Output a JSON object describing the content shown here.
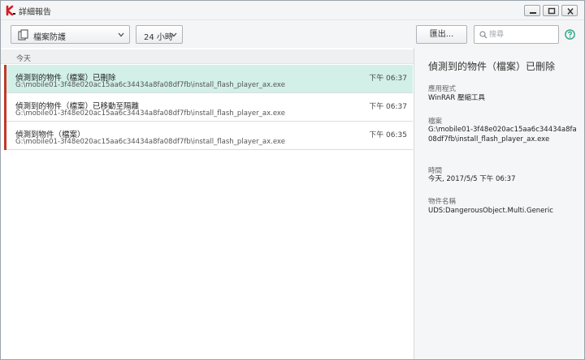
{
  "window": {
    "title": "詳細報告"
  },
  "toolbar": {
    "component_dropdown": "檔案防護",
    "period_dropdown": "24 小時",
    "export_label": "匯出...",
    "search_placeholder": "搜尋"
  },
  "list": {
    "group_label": "今天",
    "events": [
      {
        "title": "偵測到的物件（檔案）已刪除",
        "path": "G:\\mobile01-3f48e020ac15aa6c34434a8fa08df7fb\\install_flash_player_ax.exe",
        "time": "下午 06:37"
      },
      {
        "title": "偵測到的物件（檔案）已移動至隔離",
        "path": "G:\\mobile01-3f48e020ac15aa6c34434a8fa08df7fb\\install_flash_player_ax.exe",
        "time": "下午 06:37"
      },
      {
        "title": "偵測到物件（檔案）",
        "path": "G:\\mobile01-3f48e020ac15aa6c34434a8fa08df7fb\\install_flash_player_ax.exe",
        "time": "下午 06:35"
      }
    ]
  },
  "detail": {
    "title": "偵測到的物件（檔案）已刪除",
    "application_label": "應用程式",
    "application_value": "WinRAR 壓縮工具",
    "file_label": "檔案",
    "file_value": "G:\\mobile01-3f48e020ac15aa6c34434a8fa08df7fb\\install_flash_player_ax.exe",
    "time_label": "時間",
    "time_value": "今天, 2017/5/5 下午 06:37",
    "object_label": "物件名稱",
    "object_value": "UDS:DangerousObject.Multi.Generic"
  },
  "colors": {
    "accent": "#2aa585",
    "selected_row": "#d2efe8",
    "threat_marker": "#c0392b"
  }
}
